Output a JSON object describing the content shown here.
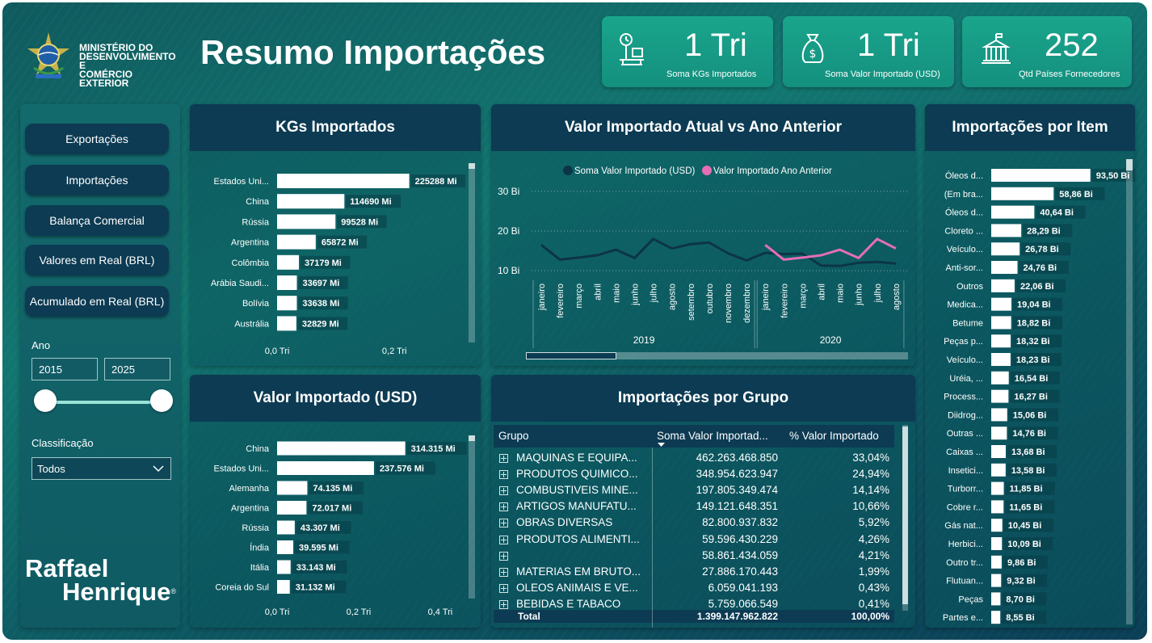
{
  "header": {
    "title": "Resumo Importações",
    "org_line1": "MINISTÉRIO DO",
    "org_line2": "DESENVOLVIMENTO E",
    "org_line3": "COMÉRCIO EXTERIOR"
  },
  "kpis": [
    {
      "value": "1 Tri",
      "label": "Soma KGs Importados",
      "icon": "scale-icon"
    },
    {
      "value": "1 Tri",
      "label": "Soma Valor Importado (USD)",
      "icon": "money-bag-icon"
    },
    {
      "value": "252",
      "label": "Qtd Países Fornecedores",
      "icon": "building-icon"
    }
  ],
  "sidebar": {
    "nav": [
      "Exportações",
      "Importações",
      "Balança Comercial",
      "Valores em Real (BRL)",
      "Acumulado em Real (BRL)"
    ],
    "year_label": "Ano",
    "year_from": "2015",
    "year_to": "2025",
    "class_label": "Classificação",
    "class_value": "Todos",
    "brand_line1": "Raffael",
    "brand_line2": "Henrique",
    "brand_reg": "®"
  },
  "colors": {
    "bar": "#ffffff",
    "line_current": "#0d3448",
    "line_previous": "#e56fb4",
    "header": "#0c3b53"
  },
  "chart_data": [
    {
      "type": "bar",
      "title": "KGs Importados",
      "orientation": "horizontal",
      "categories": [
        "Estados Uni...",
        "China",
        "Rússia",
        "Argentina",
        "Colômbia",
        "Arábia Saudi...",
        "Bolívia",
        "Austrália"
      ],
      "values": [
        225288,
        114690,
        99528,
        65872,
        37179,
        33697,
        33638,
        32829
      ],
      "labels": [
        "225288 Mi",
        "114690 Mi",
        "99528 Mi",
        "65872 Mi",
        "37179 Mi",
        "33697 Mi",
        "33638 Mi",
        "32829 Mi"
      ],
      "xticks": [
        "0,0 Tri",
        "0,2 Tri"
      ],
      "xtick_values": [
        0,
        200000
      ],
      "xlim": [
        0,
        230000
      ]
    },
    {
      "type": "bar",
      "title": "Valor Importado (USD)",
      "orientation": "horizontal",
      "categories": [
        "China",
        "Estados Uni...",
        "Alemanha",
        "Argentina",
        "Rússia",
        "Índia",
        "Itália",
        "Coreia do Sul"
      ],
      "values": [
        314315,
        237576,
        74135,
        72017,
        43307,
        39595,
        33143,
        31132
      ],
      "labels": [
        "314.315 Mi",
        "237.576 Mi",
        "74.135 Mi",
        "72.017 Mi",
        "43.307 Mi",
        "39.595 Mi",
        "33.143 Mi",
        "31.132 Mi"
      ],
      "xticks": [
        "0,0 Tri",
        "0,2 Tri",
        "0,4 Tri"
      ],
      "xtick_values": [
        0,
        200000,
        400000
      ],
      "xlim": [
        0,
        420000
      ]
    },
    {
      "type": "line",
      "title": "Valor Importado Atual vs Ano Anterior",
      "months": [
        "janeiro",
        "fevereiro",
        "março",
        "abril",
        "maio",
        "junho",
        "julho",
        "agosto",
        "setembro",
        "outubro",
        "novembro",
        "dezembro",
        "janeiro",
        "fevereiro",
        "março",
        "abril",
        "maio",
        "junho",
        "julho",
        "agosto"
      ],
      "years": [
        {
          "label": "2019",
          "start": 0,
          "end": 11
        },
        {
          "label": "2020",
          "start": 12,
          "end": 19
        }
      ],
      "yticks": [
        "10 Bi",
        "20 Bi",
        "30 Bi"
      ],
      "ytick_values": [
        10,
        20,
        30
      ],
      "ylim": [
        8,
        32
      ],
      "series": [
        {
          "name": "Soma Valor Importado (USD)",
          "values": [
            16.5,
            12.8,
            13.3,
            13.9,
            15.3,
            13.2,
            18.0,
            15.6,
            16.7,
            17.1,
            14.4,
            12.6,
            14.5,
            14.2,
            14.3,
            11.3,
            11.2,
            12.0,
            12.2,
            11.8
          ]
        },
        {
          "name": "Valor Importado Ano Anterior",
          "values": [
            null,
            null,
            null,
            null,
            null,
            null,
            null,
            null,
            null,
            null,
            null,
            null,
            16.5,
            12.8,
            13.3,
            13.9,
            15.3,
            13.2,
            18.0,
            15.6
          ]
        }
      ]
    },
    {
      "type": "bar",
      "title": "Importações por Item",
      "orientation": "horizontal",
      "categories": [
        "Óleos d...",
        "(Em bra...",
        "Óleos d...",
        "Cloreto ...",
        "Veículo...",
        "Anti-sor...",
        "Outros",
        "Medica...",
        "Betume",
        "Peças p...",
        "Veículo...",
        "Uréia, ...",
        "Process...",
        "Diidrog...",
        "Outras ...",
        "Caixas ...",
        "Insetici...",
        "Turborr...",
        "Cobre r...",
        "Gás nat...",
        "Herbici...",
        "Outro tr...",
        "Flutuan...",
        "Peças",
        "Partes e..."
      ],
      "values": [
        93.5,
        58.86,
        40.64,
        28.29,
        26.78,
        24.76,
        22.06,
        19.04,
        18.82,
        18.32,
        18.23,
        16.54,
        16.27,
        15.06,
        14.76,
        13.68,
        13.58,
        11.85,
        11.65,
        10.45,
        10.09,
        9.86,
        9.32,
        8.7,
        8.55
      ],
      "labels": [
        "93,50 Bi",
        "58,86 Bi",
        "40,64 Bi",
        "28,29 Bi",
        "26,78 Bi",
        "24,76 Bi",
        "22,06 Bi",
        "19,04 Bi",
        "18,82 Bi",
        "18,32 Bi",
        "18,23 Bi",
        "16,54 Bi",
        "16,27 Bi",
        "15,06 Bi",
        "14,76 Bi",
        "13,68 Bi",
        "13,58 Bi",
        "11,85 Bi",
        "11,65 Bi",
        "10,45 Bi",
        "10,09 Bi",
        "9,86 Bi",
        "9,32 Bi",
        "8,70 Bi",
        "8,55 Bi"
      ],
      "xlim": [
        0,
        96
      ]
    }
  ],
  "grupo_table": {
    "title": "Importações por Grupo",
    "columns": [
      "Grupo",
      "Soma Valor Importad...",
      "% Valor Importado"
    ],
    "rows": [
      {
        "grupo": "MAQUINAS E EQUIPA...",
        "valor": "462.263.468.850",
        "pct": "33,04%"
      },
      {
        "grupo": "PRODUTOS QUIMICO...",
        "valor": "348.954.623.947",
        "pct": "24,94%"
      },
      {
        "grupo": "COMBUSTIVEIS MINE...",
        "valor": "197.805.349.474",
        "pct": "14,14%"
      },
      {
        "grupo": "ARTIGOS MANUFATU...",
        "valor": "149.121.648.351",
        "pct": "10,66%"
      },
      {
        "grupo": "OBRAS DIVERSAS",
        "valor": "82.800.937.832",
        "pct": "5,92%"
      },
      {
        "grupo": "PRODUTOS ALIMENTI...",
        "valor": "59.596.430.229",
        "pct": "4,26%"
      },
      {
        "grupo": "",
        "valor": "58.861.434.059",
        "pct": "4,21%"
      },
      {
        "grupo": "MATERIAS EM BRUTO...",
        "valor": "27.886.170.443",
        "pct": "1,99%"
      },
      {
        "grupo": "OLEOS ANIMAIS E VE...",
        "valor": "6.059.041.193",
        "pct": "0,43%"
      },
      {
        "grupo": "BEBIDAS E TABACO",
        "valor": "5.759.066.549",
        "pct": "0,41%"
      }
    ],
    "total_label": "Total",
    "total_valor": "1.399.147.962.822",
    "total_pct": "100,00%"
  }
}
